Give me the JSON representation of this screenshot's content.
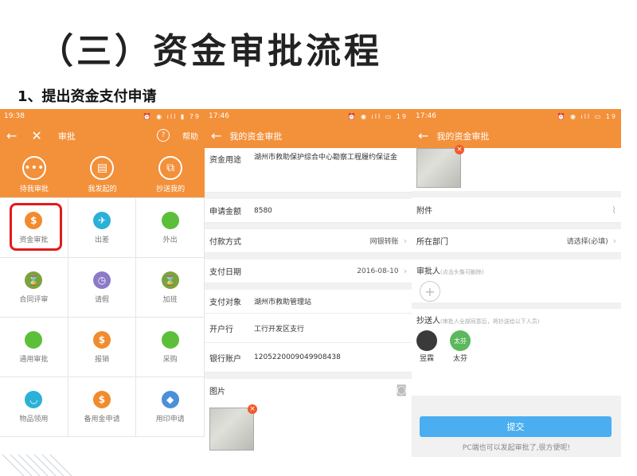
{
  "slide": {
    "title": "（三）资金审批流程",
    "subtitle": "1、提出资金支付申请"
  },
  "phone1": {
    "status": {
      "time": "19:38",
      "battery": "79"
    },
    "nav": {
      "title": "审批",
      "help": "帮助"
    },
    "tabs": [
      {
        "label": "待我审批",
        "icon": "more-icon",
        "glyph": "•••"
      },
      {
        "label": "我发起的",
        "icon": "document-icon",
        "glyph": "▤"
      },
      {
        "label": "抄送我的",
        "icon": "copy-icon",
        "glyph": "⧉"
      }
    ],
    "grid": [
      {
        "label": "资金审批",
        "icon": "money-bag-icon",
        "glyph": "$",
        "color": "#f28a2e"
      },
      {
        "label": "出差",
        "icon": "plane-icon",
        "glyph": "✈",
        "color": "#2bb1d7"
      },
      {
        "label": "外出",
        "icon": "globe-icon",
        "glyph": "",
        "color": "#5cbf3a"
      },
      {
        "label": "合同评审",
        "icon": "hourglass-icon",
        "glyph": "⌛",
        "color": "#7aa43b"
      },
      {
        "label": "请假",
        "icon": "clock-icon",
        "glyph": "◷",
        "color": "#8c79c7"
      },
      {
        "label": "加班",
        "icon": "hourglass-icon",
        "glyph": "⌛",
        "color": "#7aa43b"
      },
      {
        "label": "通用审批",
        "icon": "globe-icon",
        "glyph": "",
        "color": "#5cbf3a"
      },
      {
        "label": "报销",
        "icon": "money-bag-icon",
        "glyph": "$",
        "color": "#f28a2e"
      },
      {
        "label": "采购",
        "icon": "globe-icon",
        "glyph": "",
        "color": "#5cbf3a"
      },
      {
        "label": "物品领用",
        "icon": "bag-icon",
        "glyph": "◡",
        "color": "#2bb1d7"
      },
      {
        "label": "备用金申请",
        "icon": "money-bag-icon",
        "glyph": "$",
        "color": "#f28a2e"
      },
      {
        "label": "用印申请",
        "icon": "stamp-icon",
        "glyph": "◆",
        "color": "#4a90d9"
      }
    ]
  },
  "phone2": {
    "status": {
      "time": "17:46",
      "battery": "19"
    },
    "nav": {
      "title": "我的资金审批"
    },
    "fields": {
      "purpose_label": "资金用途",
      "purpose": "湖州市救助保护综合中心勘察工程履约保证金",
      "amount_label": "申请金额",
      "amount": "8580",
      "method_label": "付款方式",
      "method": "网银转账",
      "date_label": "支付日期",
      "date": "2016-08-10",
      "payee_label": "支付对象",
      "payee": "湖州市救助管理站",
      "bank_label": "开户行",
      "bank": "工行开发区支行",
      "account_label": "银行账户",
      "account": "1205220009049908438",
      "image_label": "图片"
    }
  },
  "phone3": {
    "status": {
      "time": "17:46",
      "battery": "19"
    },
    "nav": {
      "title": "我的资金审批"
    },
    "attachment_label": "附件",
    "dept_label": "所在部门",
    "dept_value": "请选择(必填)",
    "approver_label": "审批人",
    "approver_hint": "(点击头像可删除)",
    "cc_label": "抄送人",
    "cc_hint": "(审批人全部同意后，将抄送给以下人员)",
    "cc_people": [
      {
        "name": "昱霖",
        "badge": "",
        "color": "#3a3a3a"
      },
      {
        "name": "太芬",
        "badge": "太芬",
        "color": "#5cb85c"
      }
    ],
    "submit": "提交",
    "footer_hint": "PC端也可以发起审批了,很方便呢!"
  }
}
